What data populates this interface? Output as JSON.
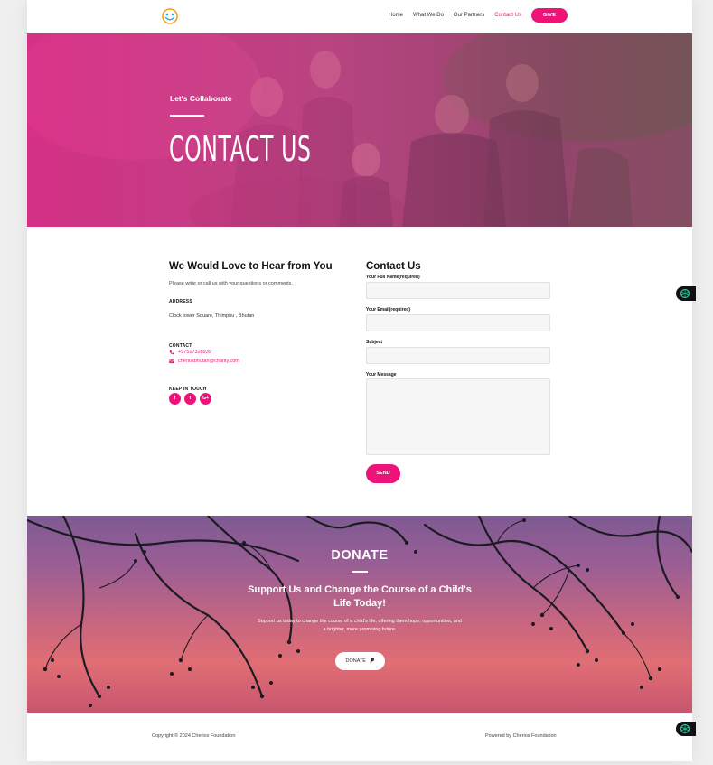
{
  "nav": {
    "items": [
      {
        "label": "Home",
        "active": false
      },
      {
        "label": "What We Do",
        "active": false
      },
      {
        "label": "Our Partners",
        "active": false
      },
      {
        "label": "Contact Us",
        "active": true
      }
    ],
    "give_label": "GIVE"
  },
  "hero": {
    "kicker": "Let's Collaborate",
    "title": "CONTACT US"
  },
  "info": {
    "title": "We Would Love to Hear from You",
    "description": "Please write or call us with your questions or comments.",
    "address_heading": "ADDRESS",
    "address": "Clock tower Square, Thimphu , Bhutan",
    "contact_heading": "CONTACT",
    "phone": "+97517328939",
    "email": "cheriosbhutan@charity.com",
    "keep_in_touch_heading": "KEEP IN TOUCH",
    "social": [
      "f",
      "t",
      "G+"
    ]
  },
  "form": {
    "title": "Contact Us",
    "name_label": "Your Full Name(required)",
    "email_label": "Your Email(required)",
    "subject_label": "Subject",
    "message_label": "Your Message",
    "send_label": "SEND"
  },
  "donate": {
    "title": "DONATE",
    "subtitle": "Support Us and Change the Course of a Child's Life Today!",
    "description": "Support us today to change the course of a child's life, offering them hope, opportunities, and a brighter, more promising future.",
    "button_label": "DONATE"
  },
  "footer": {
    "copyright": "Copyright © 2024 Cherios Foundation",
    "powered": "Powered by Cherios Foundation"
  },
  "colors": {
    "accent": "#ee1378",
    "hero_pink": "#e63a92",
    "footer_text": "#444444"
  }
}
